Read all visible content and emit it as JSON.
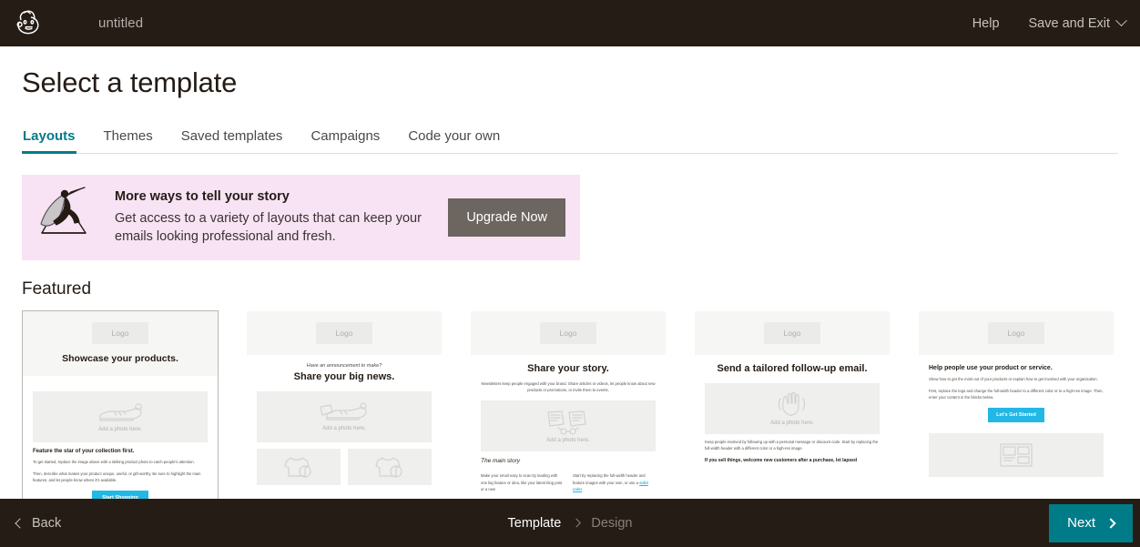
{
  "topbar": {
    "logo_icon": "mailchimp-freddie-logo",
    "campaign_title": "untitled",
    "help_label": "Help",
    "save_exit_label": "Save and Exit",
    "chevron_icon": "chevron-down-icon"
  },
  "page_title": "Select a template",
  "tabs": [
    {
      "label": "Layouts",
      "active": true
    },
    {
      "label": "Themes",
      "active": false
    },
    {
      "label": "Saved templates",
      "active": false
    },
    {
      "label": "Campaigns",
      "active": false
    },
    {
      "label": "Code your own",
      "active": false
    }
  ],
  "promo": {
    "illustration_icon": "superhero-on-mountain-illustration",
    "heading": "More ways to tell your story",
    "body": "Get access to a variety of layouts that can keep your emails looking professional and fresh.",
    "button_label": "Upgrade Now",
    "background_color": "#f8e3f4",
    "button_color": "#6c6560"
  },
  "section_heading": "Featured",
  "cards": [
    {
      "name": "showcase-your-products",
      "hovered": true,
      "logo_placeholder": "Logo",
      "title": "Showcase your products.",
      "photo_caption": "Add a photo here.",
      "photo_icon": "shoe-illustration",
      "section_heading": "Feature the star of your collection first.",
      "paragraphs": [
        "To get started, replace the image above with a striking product photo to catch people's attention.",
        "Then, describe what makes your product unique, useful, or gift-worthy. Be sure to highlight the main features, and let people know where it's available."
      ],
      "cta_label": "Start Shopping"
    },
    {
      "name": "share-your-big-news",
      "hovered": false,
      "logo_placeholder": "Logo",
      "kicker": "Have an announcement to make?",
      "title": "Share your big news.",
      "photo_caption": "Add a photo here.",
      "photo_icon": "shoe-with-discount-tag-illustration",
      "sub_photo_icon": "tshirt-with-50-percent-tag-illustration"
    },
    {
      "name": "share-your-story",
      "hovered": false,
      "logo_placeholder": "Logo",
      "title": "Share your story.",
      "subtitle": "Newsletters keep people engaged with your brand. Share articles or videos, let people know about new products or promotions, or invite them to events.",
      "photo_caption": "Add a photo here.",
      "photo_icon": "newspaper-and-glasses-illustration",
      "section_heading": "The main story",
      "col_left": "Make your email easy to scan by leading with one big feature or idea, like your latest blog post or a new",
      "col_right": "Start by replacing the full-width header and feature images with your own, or use a ",
      "col_right_link": "solid color"
    },
    {
      "name": "send-a-tailored-follow-up-email",
      "hovered": false,
      "logo_placeholder": "Logo",
      "title": "Send a tailored follow-up email.",
      "photo_caption": "Add a photo here.",
      "photo_icon": "waving-hand-illustration",
      "paragraphs": [
        "Keep people involved by following up with a personal message or discount code. Start by replacing the full-width header with a different color or a high-res image.",
        "If you sell things, welcome new customers after a purchase, let lapsed"
      ]
    },
    {
      "name": "help-people-use-your-product-or-service",
      "hovered": false,
      "logo_placeholder": "Logo",
      "title": "Help people use your product or service.",
      "paragraphs": [
        "Show how to get the most out of your products or explain how to get involved with your organization.",
        "First, replace the logo and change the full-width header to a different color or to a high-res image. Then, enter your content in the blocks below."
      ],
      "cta_label": "Let's Get Started",
      "photo_icon": "layout-blocks-illustration"
    }
  ],
  "bottombar": {
    "back_label": "Back",
    "back_icon": "chevron-left-icon",
    "crumb_current": "Template",
    "crumb_next": "Design",
    "crumb_separator_icon": "chevron-right-icon",
    "next_label": "Next",
    "next_icon": "chevron-right-icon",
    "next_color": "#007c89"
  }
}
